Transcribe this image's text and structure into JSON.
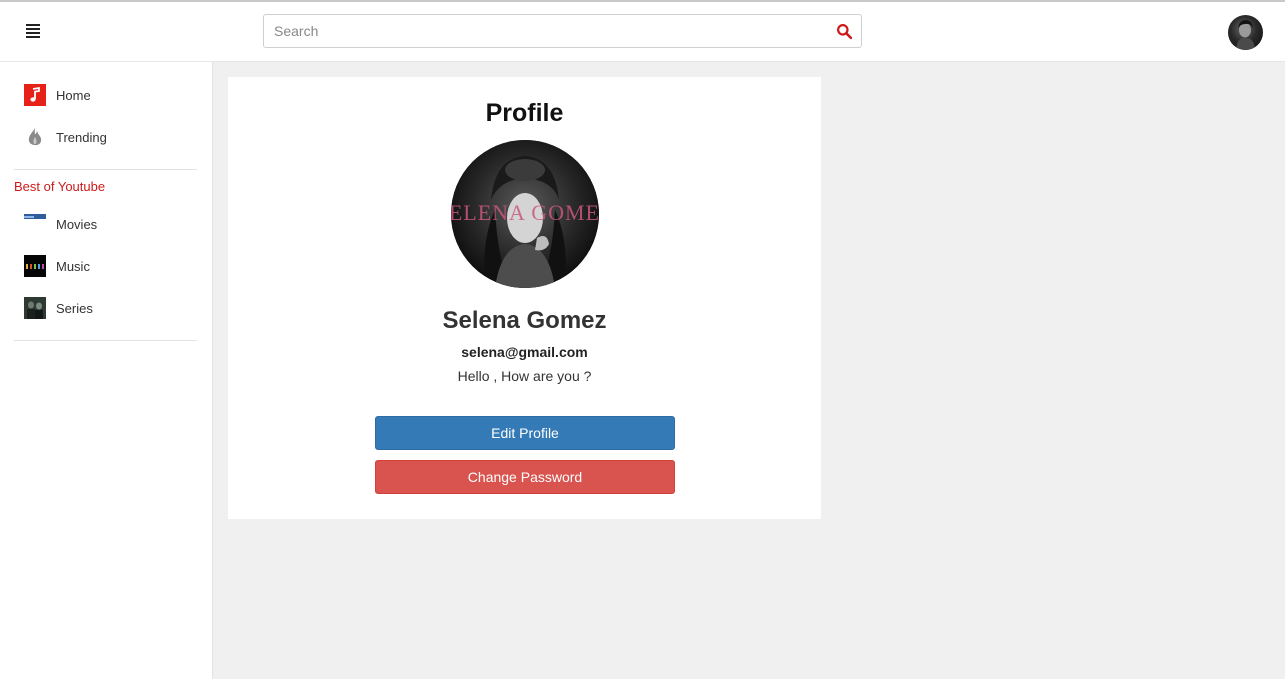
{
  "header": {
    "menu_icon": "hamburger-menu-icon",
    "search": {
      "placeholder": "Search",
      "value": "",
      "icon": "search-icon"
    },
    "avatar_icon": "user-avatar",
    "colors": {
      "search_icon": "#cc1b1b"
    }
  },
  "sidebar": {
    "items": [
      {
        "label": "Home",
        "icon": "music-note-icon"
      },
      {
        "label": "Trending",
        "icon": "flame-icon"
      }
    ],
    "section_title": "Best of Youtube",
    "section_items": [
      {
        "label": "Movies",
        "icon": "movies-thumbnail"
      },
      {
        "label": "Music",
        "icon": "music-thumbnail"
      },
      {
        "label": "Series",
        "icon": "series-thumbnail"
      }
    ]
  },
  "profile": {
    "title": "Profile",
    "image_caption": "SELENA GOMEZ",
    "name": "Selena Gomez",
    "email": "selena@gmail.com",
    "status": "Hello , How are you ?",
    "edit_label": "Edit Profile",
    "password_label": "Change Password"
  },
  "colors": {
    "accent_red": "#cc1b1b",
    "primary_button": "#337ab7",
    "danger_button": "#d9534f",
    "background": "#f0f0f0"
  }
}
